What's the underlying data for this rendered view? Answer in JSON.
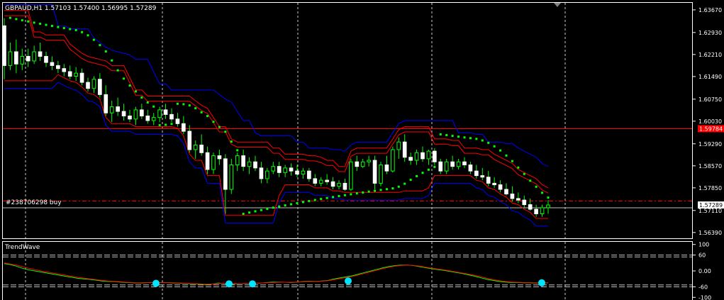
{
  "window_title": "GBPAUD,H1  1.57103 1.57400 1.56995 1.57289",
  "order_label": "#238706298 buy",
  "price_panel": {
    "ylim": [
      1.562,
      1.639
    ],
    "ticks": [
      "1.63670",
      "1.62930",
      "1.62210",
      "1.61490",
      "1.60750",
      "1.60030",
      "1.59290",
      "1.58570",
      "1.57850",
      "1.57110",
      "1.56390"
    ],
    "tick_values": [
      1.6367,
      1.6293,
      1.6221,
      1.6149,
      1.6075,
      1.6003,
      1.5929,
      1.5857,
      1.5785,
      1.5711,
      1.5639
    ],
    "current_price_label": "1.57289",
    "current_price": 1.57289,
    "level_line_label": "1.59784",
    "level_line": 1.59784,
    "order_price": 1.5742
  },
  "indicator_panel": {
    "name": "TrendWave",
    "ylim": [
      -110,
      110
    ],
    "ticks": [
      "100",
      "60",
      "0.00",
      "-60",
      "-100"
    ],
    "tick_values": [
      100,
      60,
      0,
      -60,
      -100
    ],
    "levels": [
      60,
      53,
      -60,
      -53
    ]
  },
  "colors": {
    "background": "#000000",
    "bull_candle": "#ffffff",
    "bear_candle": "#00ff00",
    "wick": "#00ff00",
    "outer_band": "#0000ff",
    "inner_band": "#ff0000",
    "sar": "#00ff00",
    "level_line": "#ff0000",
    "current_price_bg": "#ff0000",
    "grid": "#ffffff",
    "wave_fast": "#00ff00",
    "wave_slow": "#ff0000",
    "signal_dot": "#00e5ff"
  },
  "chart_data": [
    {
      "type": "candlestick",
      "title": "GBPAUD,H1",
      "series": [
        {
          "name": "GBPAUD,H1",
          "ohlc": [
            [
              1.6315,
              1.634,
              1.614,
              1.6185
            ],
            [
              1.6185,
              1.626,
              1.617,
              1.623
            ],
            [
              1.623,
              1.627,
              1.616,
              1.619
            ],
            [
              1.619,
              1.624,
              1.617,
              1.6215
            ],
            [
              1.6215,
              1.624,
              1.618,
              1.62
            ],
            [
              1.62,
              1.625,
              1.619,
              1.623
            ],
            [
              1.623,
              1.626,
              1.62,
              1.6215
            ],
            [
              1.6215,
              1.623,
              1.618,
              1.6195
            ],
            [
              1.6195,
              1.6215,
              1.617,
              1.6185
            ],
            [
              1.6185,
              1.62,
              1.616,
              1.6175
            ],
            [
              1.6175,
              1.619,
              1.615,
              1.6165
            ],
            [
              1.6165,
              1.6185,
              1.614,
              1.615
            ],
            [
              1.615,
              1.618,
              1.6135,
              1.616
            ],
            [
              1.616,
              1.6175,
              1.612,
              1.613
            ],
            [
              1.613,
              1.6145,
              1.61,
              1.611
            ],
            [
              1.611,
              1.615,
              1.6095,
              1.614
            ],
            [
              1.614,
              1.616,
              1.608,
              1.609
            ],
            [
              1.609,
              1.612,
              1.602,
              1.603
            ],
            [
              1.603,
              1.607,
              1.6,
              1.605
            ],
            [
              1.605,
              1.608,
              1.602,
              1.6035
            ],
            [
              1.6035,
              1.606,
              1.6005,
              1.602
            ],
            [
              1.602,
              1.604,
              1.6,
              1.601
            ],
            [
              1.601,
              1.605,
              1.599,
              1.604
            ],
            [
              1.604,
              1.606,
              1.601,
              1.602
            ],
            [
              1.602,
              1.604,
              1.5995,
              1.6005
            ],
            [
              1.6005,
              1.603,
              1.599,
              1.6015
            ],
            [
              1.6015,
              1.605,
              1.6,
              1.604
            ],
            [
              1.604,
              1.606,
              1.601,
              1.6025
            ],
            [
              1.6025,
              1.6045,
              1.6,
              1.601
            ],
            [
              1.601,
              1.603,
              1.5985,
              1.5995
            ],
            [
              1.5995,
              1.602,
              1.596,
              1.597
            ],
            [
              1.597,
              1.599,
              1.59,
              1.591
            ],
            [
              1.591,
              1.594,
              1.588,
              1.5925
            ],
            [
              1.5925,
              1.596,
              1.589,
              1.59
            ],
            [
              1.59,
              1.592,
              1.583,
              1.5845
            ],
            [
              1.5845,
              1.59,
              1.583,
              1.589
            ],
            [
              1.589,
              1.591,
              1.586,
              1.588
            ],
            [
              1.588,
              1.5895,
              1.57,
              1.578
            ],
            [
              1.578,
              1.588,
              1.5765,
              1.586
            ],
            [
              1.586,
              1.59,
              1.584,
              1.589
            ],
            [
              1.589,
              1.591,
              1.584,
              1.5855
            ],
            [
              1.5855,
              1.5885,
              1.583,
              1.587
            ],
            [
              1.587,
              1.589,
              1.584,
              1.585
            ],
            [
              1.585,
              1.587,
              1.58,
              1.5815
            ],
            [
              1.5815,
              1.585,
              1.58,
              1.584
            ],
            [
              1.584,
              1.587,
              1.583,
              1.5855
            ],
            [
              1.5855,
              1.587,
              1.582,
              1.5835
            ],
            [
              1.5835,
              1.586,
              1.582,
              1.585
            ],
            [
              1.585,
              1.5865,
              1.5825,
              1.584
            ],
            [
              1.584,
              1.586,
              1.582,
              1.583
            ],
            [
              1.583,
              1.585,
              1.5815,
              1.584
            ],
            [
              1.584,
              1.585,
              1.5805,
              1.5815
            ],
            [
              1.5815,
              1.583,
              1.579,
              1.58
            ],
            [
              1.58,
              1.582,
              1.579,
              1.581
            ],
            [
              1.581,
              1.583,
              1.5795,
              1.5805
            ],
            [
              1.5805,
              1.582,
              1.578,
              1.579
            ],
            [
              1.579,
              1.581,
              1.578,
              1.58
            ],
            [
              1.58,
              1.5815,
              1.5775,
              1.578
            ],
            [
              1.578,
              1.588,
              1.5775,
              1.587
            ],
            [
              1.587,
              1.589,
              1.584,
              1.5855
            ],
            [
              1.5855,
              1.588,
              1.585,
              1.587
            ],
            [
              1.587,
              1.589,
              1.5855,
              1.5875
            ],
            [
              1.5875,
              1.589,
              1.578,
              1.58
            ],
            [
              1.58,
              1.587,
              1.579,
              1.586
            ],
            [
              1.586,
              1.589,
              1.583,
              1.584
            ],
            [
              1.584,
              1.592,
              1.5835,
              1.591
            ],
            [
              1.591,
              1.595,
              1.588,
              1.5935
            ],
            [
              1.5935,
              1.596,
              1.587,
              1.5885
            ],
            [
              1.5885,
              1.59,
              1.586,
              1.5875
            ],
            [
              1.5875,
              1.591,
              1.586,
              1.59
            ],
            [
              1.59,
              1.592,
              1.587,
              1.588
            ],
            [
              1.588,
              1.591,
              1.586,
              1.5905
            ],
            [
              1.5905,
              1.5915,
              1.586,
              1.587
            ],
            [
              1.587,
              1.588,
              1.583,
              1.584
            ],
            [
              1.584,
              1.588,
              1.583,
              1.587
            ],
            [
              1.587,
              1.589,
              1.5845,
              1.5855
            ],
            [
              1.5855,
              1.588,
              1.5845,
              1.587
            ],
            [
              1.587,
              1.5885,
              1.585,
              1.586
            ],
            [
              1.586,
              1.587,
              1.583,
              1.584
            ],
            [
              1.584,
              1.586,
              1.5815,
              1.5825
            ],
            [
              1.5825,
              1.585,
              1.581,
              1.582
            ],
            [
              1.582,
              1.584,
              1.579,
              1.58
            ],
            [
              1.58,
              1.582,
              1.5785,
              1.5795
            ],
            [
              1.5795,
              1.581,
              1.577,
              1.578
            ],
            [
              1.578,
              1.58,
              1.576,
              1.5765
            ],
            [
              1.5765,
              1.579,
              1.574,
              1.575
            ],
            [
              1.575,
              1.577,
              1.5735,
              1.5745
            ],
            [
              1.5745,
              1.576,
              1.572,
              1.573
            ],
            [
              1.573,
              1.575,
              1.571,
              1.5715
            ],
            [
              1.5715,
              1.573,
              1.569,
              1.57
            ],
            [
              1.57,
              1.573,
              1.569,
              1.572
            ],
            [
              1.572,
              1.5745,
              1.57,
              1.5729
            ]
          ]
        }
      ]
    },
    {
      "type": "line",
      "title": "TrendWave",
      "series": [
        {
          "values": [
            28,
            24,
            18,
            10,
            4,
            0,
            -4,
            -8,
            -12,
            -16,
            -20,
            -24,
            -28,
            -30,
            -32,
            -35,
            -38,
            -40,
            -40,
            -42,
            -44,
            -45,
            -46,
            -45,
            -44,
            -45,
            -44,
            -45,
            -46,
            -47,
            -48,
            -49,
            -50,
            -52,
            -50,
            -46,
            -48,
            -50,
            -49,
            -48,
            -47,
            -47,
            -46,
            -44,
            -42,
            -42,
            -43,
            -44,
            -42,
            -40,
            -39,
            -40,
            -38,
            -36,
            -30,
            -26,
            -22,
            -18,
            -12,
            -6,
            0,
            6,
            12,
            17,
            20,
            22,
            22,
            20,
            16,
            12,
            8,
            5,
            2,
            -2,
            -6,
            -10,
            -15,
            -20,
            -26,
            -32,
            -36,
            -40,
            -42,
            -44,
            -44,
            -45,
            -45,
            -46,
            -46,
            -45
          ]
        },
        {
          "values": [
            30,
            26,
            22,
            16,
            10,
            5,
            0,
            -4,
            -8,
            -12,
            -16,
            -20,
            -24,
            -27,
            -30,
            -33,
            -36,
            -38,
            -39,
            -41,
            -43,
            -44,
            -45,
            -44,
            -44,
            -44,
            -44,
            -44,
            -45,
            -46,
            -47,
            -48,
            -49,
            -50,
            -50,
            -48,
            -47,
            -48,
            -48,
            -48,
            -47,
            -47,
            -46,
            -45,
            -44,
            -43,
            -43,
            -43,
            -42,
            -41,
            -40,
            -40,
            -39,
            -37,
            -33,
            -29,
            -25,
            -21,
            -15,
            -9,
            -3,
            3,
            9,
            14,
            18,
            21,
            22,
            21,
            18,
            14,
            10,
            7,
            4,
            0,
            -4,
            -8,
            -12,
            -17,
            -22,
            -28,
            -33,
            -37,
            -40,
            -42,
            -43,
            -44,
            -44,
            -45,
            -45,
            -45
          ]
        }
      ]
    }
  ]
}
